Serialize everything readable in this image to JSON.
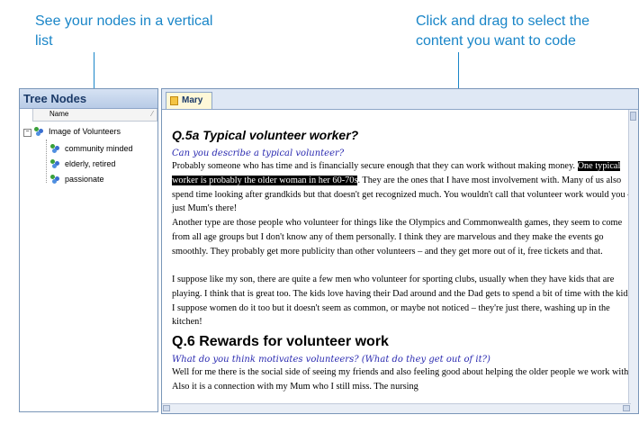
{
  "callouts": {
    "left": "See your nodes in a vertical list",
    "right": "Click and drag to select the content you want to code"
  },
  "tree": {
    "title": "Tree Nodes",
    "column_name": "Name",
    "root": "Image of Volunteers",
    "children": [
      "community minded",
      "elderly, retired",
      "passionate"
    ],
    "icon": "node-icon"
  },
  "document": {
    "tab": "Mary",
    "heading1": "Q.5a Typical volunteer worker?",
    "question1": "Can you describe a typical volunteer?",
    "p1_before": "Probably someone who has time and is financially secure enough that they can work without making money. ",
    "p1_highlight": "One typical worker is probably the older woman in her 60-70s",
    "p1_after": ". They are the ones that I have most involvement with. Many of us also spend time looking after grandkids but that doesn't get recognized much. You wouldn't call that volunteer work would you – just Mum's there!",
    "p2": "Another type are those people who volunteer for things like the Olympics and Commonwealth games, they seem to come from all age groups but I don't know any of them personally. I think they are marvelous and they make the events go smoothly. They probably get more publicity than other volunteers – and they get more out of it, free tickets and that.",
    "p3": "I suppose like my son, there are quite a few men who volunteer for sporting clubs, usually when they have kids that are playing. I think that is great too. The kids love having their Dad around and the Dad gets to spend a bit of time with the kids. I suppose women do it too but it doesn't seem as common, or maybe not noticed – they're just there, washing up in the kitchen!",
    "heading2": "Q.6 Rewards for volunteer work",
    "question2": "What do you think motivates volunteers? (What do they get out of it?)",
    "p4": "Well for me there is the social side of seeing my friends and also feeling good about helping the older people we work with. Also it is a connection with my Mum who I still miss. The nursing"
  },
  "colors": {
    "callout": "#1a86c8",
    "question": "#2a2ab0",
    "highlight_bg": "#000000"
  }
}
